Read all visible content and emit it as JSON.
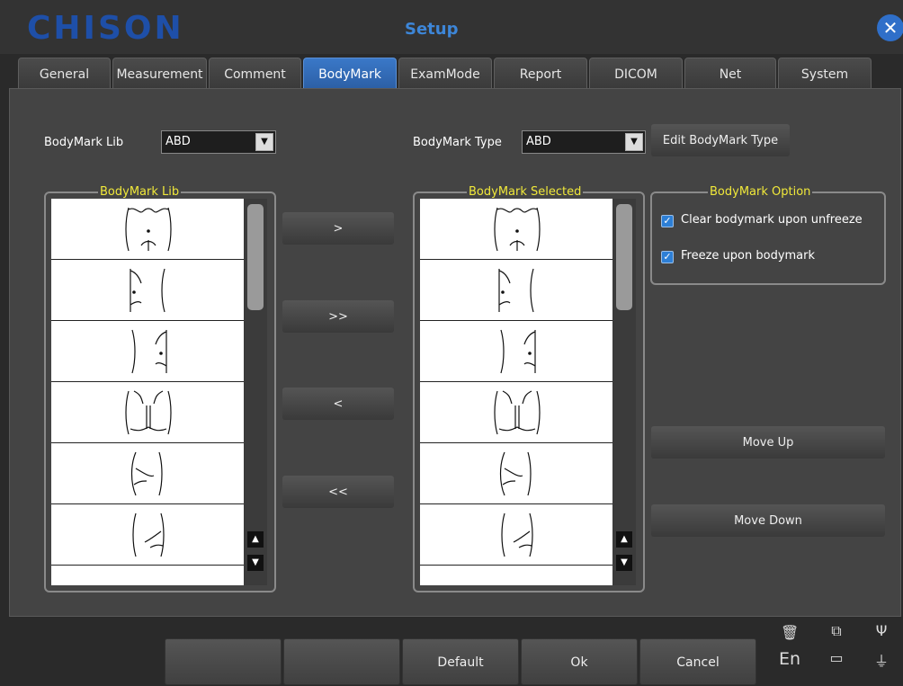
{
  "window": {
    "logo": "CHISON",
    "title": "Setup",
    "close_icon": "close-icon"
  },
  "tabs": [
    {
      "label": "General"
    },
    {
      "label": "Measurement"
    },
    {
      "label": "Comment"
    },
    {
      "label": "BodyMark",
      "active": true
    },
    {
      "label": "ExamMode"
    },
    {
      "label": "Report"
    },
    {
      "label": "DICOM"
    },
    {
      "label": "Net"
    },
    {
      "label": "System"
    }
  ],
  "bodymark_lib": {
    "label": "BodyMark Lib",
    "value": "ABD"
  },
  "bodymark_type": {
    "label": "BodyMark Type",
    "value": "ABD",
    "edit_button": "Edit BodyMark Type"
  },
  "lib_group": {
    "title": "BodyMark Lib"
  },
  "selected_group": {
    "title": "BodyMark Selected"
  },
  "transfer_buttons": {
    "add": ">",
    "add_all": ">>",
    "remove": "<",
    "remove_all": "<<"
  },
  "option_group": {
    "title": "BodyMark Option",
    "options": [
      {
        "label": "Clear bodymark upon unfreeze",
        "checked": true
      },
      {
        "label": "Freeze upon bodymark",
        "checked": true
      }
    ]
  },
  "move_buttons": {
    "up": "Move Up",
    "down": "Move Down"
  },
  "footer": {
    "blank1": "",
    "blank2": "",
    "default": "Default",
    "ok": "Ok",
    "cancel": "Cancel"
  },
  "status": {
    "language": "En"
  },
  "colors": {
    "accent": "#2f6fc9",
    "group_title": "#f0e83a",
    "panel": "#444444"
  }
}
